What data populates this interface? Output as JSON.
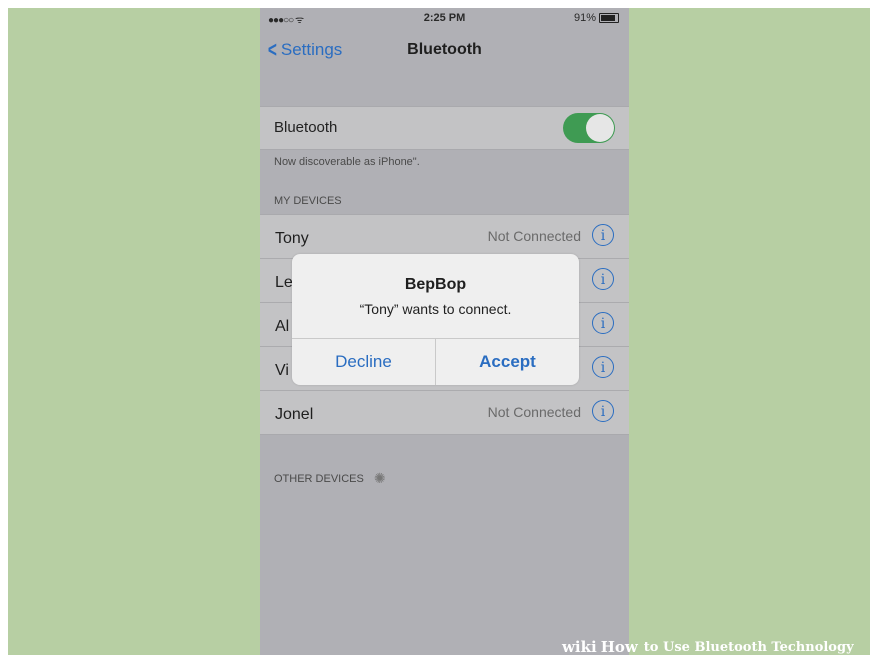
{
  "status_bar": {
    "signal": "●●●○○ ᯤ",
    "time": "2:25 PM",
    "battery": "91%"
  },
  "nav": {
    "back_label": "Settings",
    "title": "Bluetooth"
  },
  "bluetooth": {
    "label": "Bluetooth",
    "enabled": true,
    "toggle_color": "#3f9b53",
    "discoverable_text": "Now discoverable as iPhone\"."
  },
  "my_devices": {
    "header": "MY DEVICES",
    "items": [
      {
        "name": "Tony",
        "status": "Not Connected"
      },
      {
        "name": "Le",
        "status": ""
      },
      {
        "name": "Al",
        "status": ""
      },
      {
        "name": "Vi",
        "status": ""
      },
      {
        "name": "Jonel",
        "status": "Not Connected"
      }
    ]
  },
  "other_devices": {
    "header": "OTHER DEVICES"
  },
  "alert": {
    "title": "BepBop",
    "message": "“Tony” wants to connect.",
    "decline_label": "Decline",
    "accept_label": "Accept"
  },
  "watermark": {
    "wiki": "wiki",
    "how": "How",
    "text": "to Use Bluetooth Technology"
  },
  "colors": {
    "accent": "#2a6dc1",
    "background": "#b7cfa3"
  }
}
